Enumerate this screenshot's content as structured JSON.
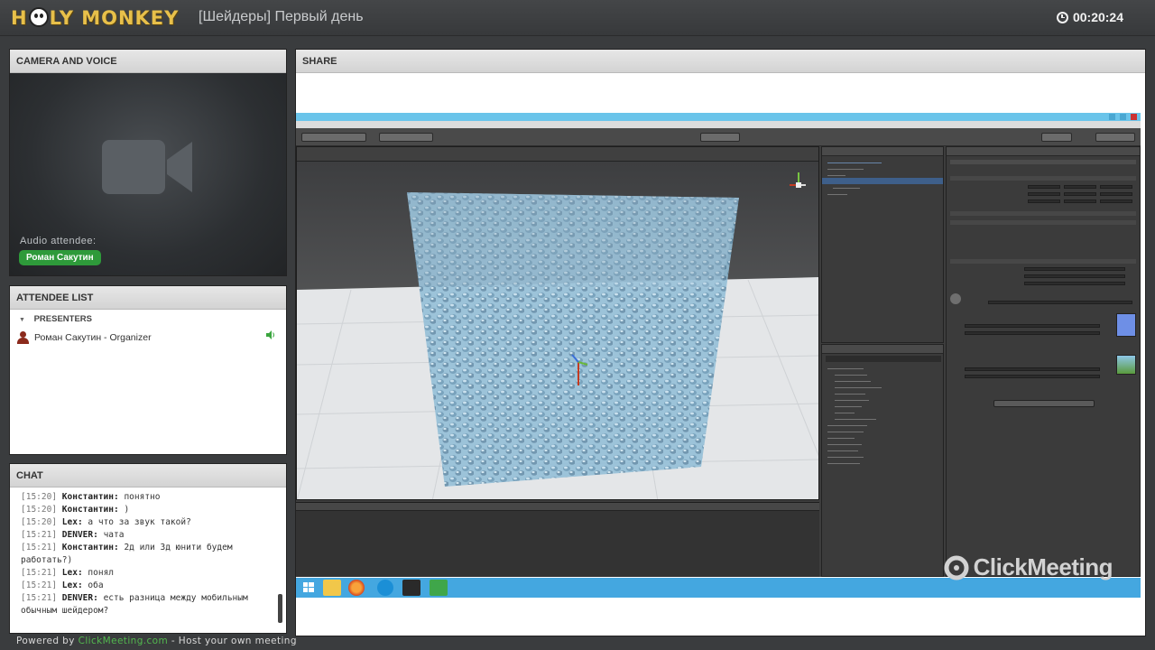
{
  "header": {
    "logo_text": "HOLY MONKEY",
    "meeting_title": "[Шейдеры] Первый день",
    "timer": "00:20:24"
  },
  "camera_panel": {
    "title": "CAMERA AND VOICE",
    "audio_label": "Audio attendee:",
    "speaker_name": "Роман Сакутин"
  },
  "attendee_panel": {
    "title": "ATTENDEE LIST",
    "group_label": "PRESENTERS",
    "attendees": [
      {
        "name": "Роман Сакутин - Organizer"
      }
    ]
  },
  "chat_panel": {
    "title": "CHAT",
    "messages": [
      {
        "time": "[15:20]",
        "author": "Константин:",
        "text": "понятно"
      },
      {
        "time": "[15:20]",
        "author": "Константин:",
        "text": ")"
      },
      {
        "time": "[15:20]",
        "author": "Lex:",
        "text": "а что за звук такой?"
      },
      {
        "time": "[15:21]",
        "author": "DENVER:",
        "text": "чата"
      },
      {
        "time": "[15:21]",
        "author": "Константин:",
        "text": "2д или 3д юнити будем работать?)"
      },
      {
        "time": "[15:21]",
        "author": "Lex:",
        "text": "понял"
      },
      {
        "time": "[15:21]",
        "author": "Lex:",
        "text": "оба"
      },
      {
        "time": "[15:21]",
        "author": "DENVER:",
        "text": "есть разница между мобильным обычным шейдером?"
      }
    ]
  },
  "share_panel": {
    "title": "SHARE"
  },
  "footer": {
    "powered_prefix": "Powered by",
    "powered_link": "ClickMeeting.com",
    "powered_suffix": "- Host your own meeting"
  },
  "watermark": {
    "text": "ClickMeeting"
  },
  "colors": {
    "speaker_pill": "#2e9a3a",
    "taskbar": "#44a7e0",
    "titlebar": "#6ac4ea",
    "logo": "#e8c04a"
  }
}
